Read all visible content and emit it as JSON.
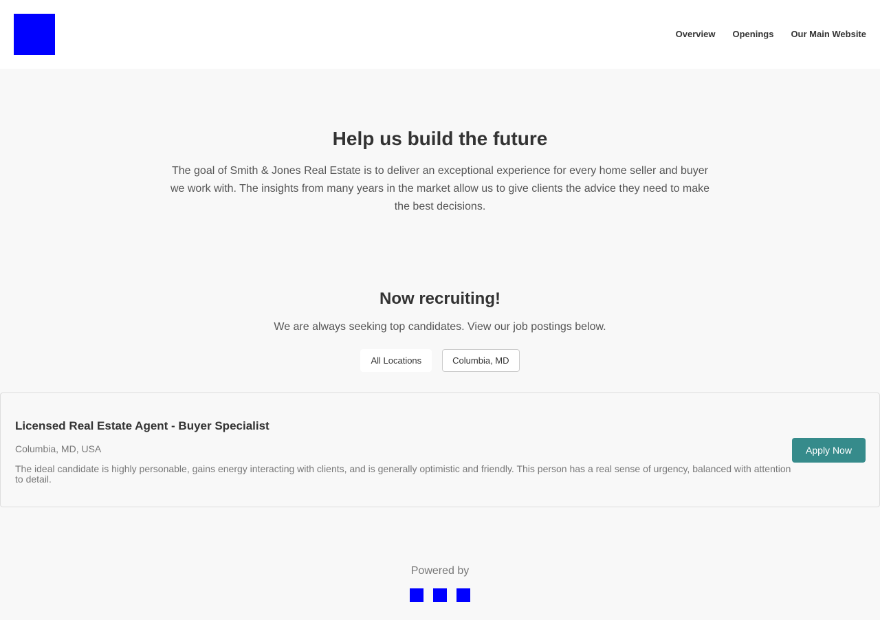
{
  "header": {
    "nav": [
      "Overview",
      "Openings",
      "Our Main Website"
    ]
  },
  "hero": {
    "title": "Help us build the future",
    "text": "The goal of Smith & Jones Real Estate is to deliver an exceptional experience for every home seller and buyer we work with. The insights from many years in the market allow us to give clients the advice they need to make the best decisions."
  },
  "recruit": {
    "title": "Now recruiting!",
    "text": "We are always seeking top candidates. View our job postings below.",
    "filters": [
      "All Locations",
      "Columbia, MD"
    ]
  },
  "job": {
    "title": "Licensed Real Estate Agent - Buyer Specialist",
    "location": "Columbia, MD, USA",
    "description": "The ideal candidate is highly personable, gains energy interacting with clients, and is generally optimistic and friendly. This person has a real sense of urgency, balanced with attention to detail.",
    "apply": "Apply Now"
  },
  "footer": {
    "powered_by": "Powered by"
  },
  "colors": {
    "accent": "#368b8b",
    "logo": "#0000ff"
  }
}
